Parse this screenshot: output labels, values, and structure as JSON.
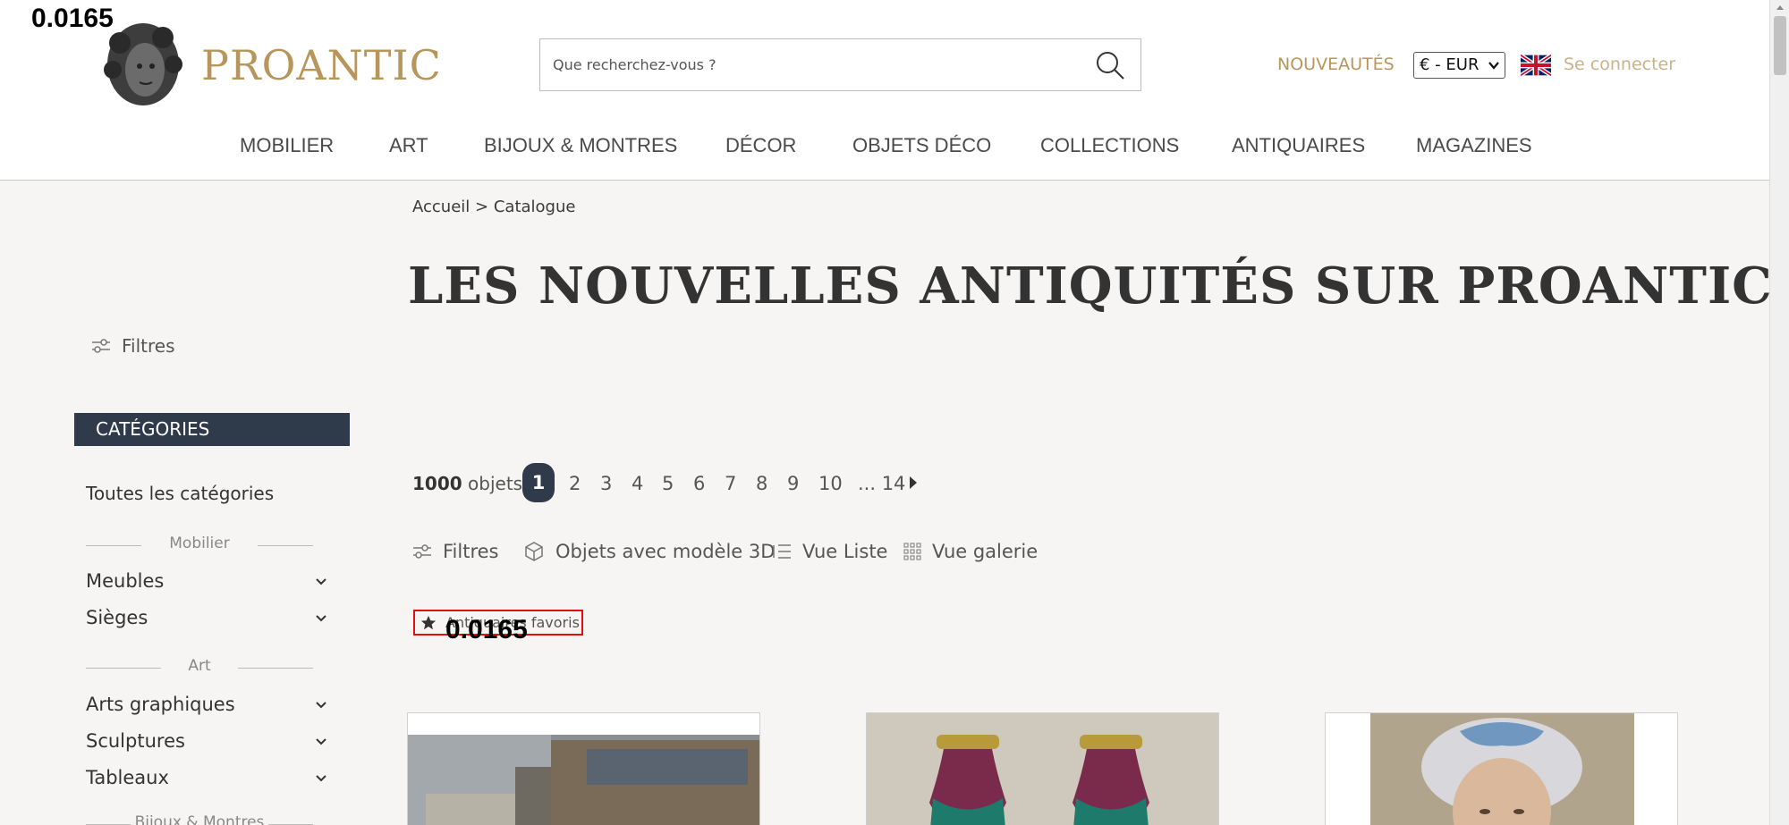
{
  "overlay": {
    "top_value": "0.0165",
    "mid_value": "0.0165"
  },
  "header": {
    "brand": "PROANTIC",
    "search_placeholder": "Que recherchez-vous ?",
    "nouveautes": "NOUVEAUTÉS",
    "currency": "€ - EUR",
    "login": "Se connecter",
    "accent_color": "#b8955a"
  },
  "nav": [
    "MOBILIER",
    "ART",
    "BIJOUX & MONTRES",
    "DÉCOR",
    "OBJETS DÉCO",
    "COLLECTIONS",
    "ANTIQUAIRES",
    "MAGAZINES"
  ],
  "breadcrumb": {
    "home": "Accueil",
    "sep": ">",
    "current": "Catalogue"
  },
  "page_title": "LES NOUVELLES ANTIQUITÉS SUR PROANTIC",
  "sidebar": {
    "filters_label": "Filtres",
    "categories_header": "CATÉGORIES",
    "all_categories": "Toutes les catégories",
    "groups": [
      "Mobilier",
      "Art",
      "Bijoux & Montres"
    ],
    "items": [
      "Meubles",
      "Sièges",
      "Arts graphiques",
      "Sculptures",
      "Tableaux"
    ]
  },
  "pagination": {
    "count": "1000",
    "count_suffix": "objets",
    "pages": [
      "1",
      "2",
      "3",
      "4",
      "5",
      "6",
      "7",
      "8",
      "9",
      "10",
      "... 14"
    ]
  },
  "toolbar": {
    "filters": "Filtres",
    "model3d": "Objets avec modèle 3D",
    "list_view": "Vue Liste",
    "gallery_view": "Vue galerie",
    "favorites": "Antiquaires favoris"
  }
}
